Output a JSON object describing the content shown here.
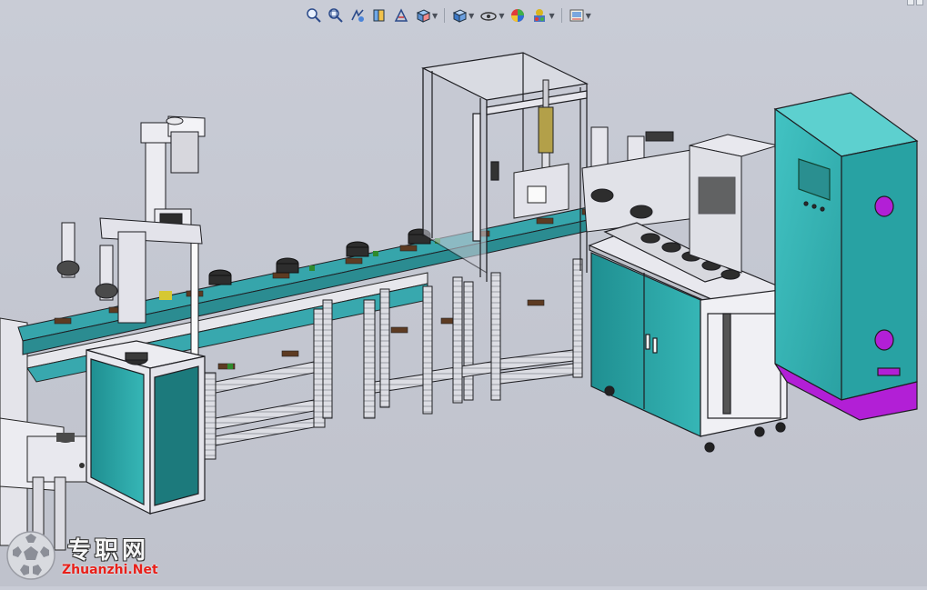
{
  "app": {
    "toolbar": {
      "buttons": [
        {
          "icon": "zoom-to-fit-icon"
        },
        {
          "icon": "zoom-to-area-icon"
        },
        {
          "icon": "previous-view-icon"
        },
        {
          "icon": "section-view-icon"
        },
        {
          "icon": "dynamic-annotation-icon"
        },
        {
          "icon": "view-orientation-icon",
          "dropdown": true
        },
        {
          "icon": "display-style-icon",
          "dropdown": true
        },
        {
          "icon": "hide-show-items-icon",
          "dropdown": true
        },
        {
          "icon": "edit-appearance-icon"
        },
        {
          "icon": "apply-scene-icon",
          "dropdown": true
        },
        {
          "icon": "view-settings-icon",
          "dropdown": true
        }
      ]
    },
    "colors": {
      "background": "#c6c9d3",
      "frame": "#e6e6ec",
      "panel_teal": "#2aa6a6",
      "cabinet_teal": "#3bb8b8",
      "accent_magenta": "#b21fd6",
      "conveyor_teal": "#37a7ad",
      "dark_outline": "#1e1e22",
      "brass": "#b3a049"
    }
  },
  "watermark": {
    "cn_text": "专职网",
    "en_text": "Zhuanzhi.Net",
    "logo_icon": "soccer-ball-icon"
  }
}
